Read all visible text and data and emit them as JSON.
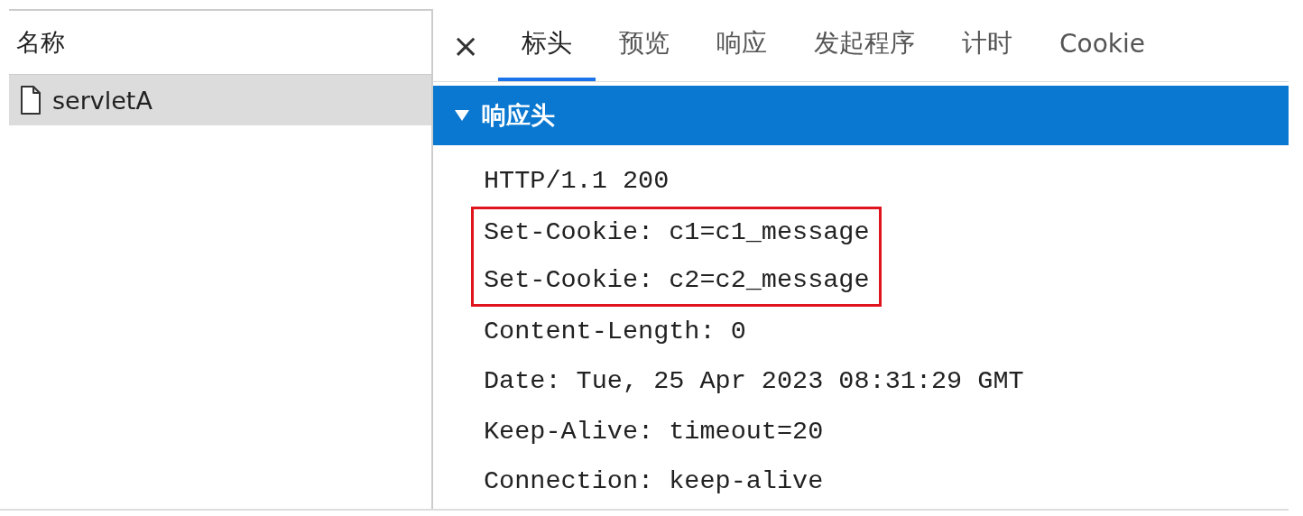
{
  "request_list": {
    "header": "名称",
    "items": [
      {
        "name": "servletA",
        "selected": true
      }
    ]
  },
  "close_label": "×",
  "tabs": [
    {
      "label": "标头",
      "selected": true
    },
    {
      "label": "预览",
      "selected": false
    },
    {
      "label": "响应",
      "selected": false
    },
    {
      "label": "发起程序",
      "selected": false
    },
    {
      "label": "计时",
      "selected": false
    },
    {
      "label": "Cookie",
      "selected": false
    }
  ],
  "section": {
    "title": "响应头",
    "expanded": true,
    "lines": [
      {
        "text": "HTTP/1.1 200",
        "highlighted": false
      },
      {
        "text": "Set-Cookie: c1=c1_message",
        "highlighted": true
      },
      {
        "text": "Set-Cookie: c2=c2_message",
        "highlighted": true
      },
      {
        "text": "Content-Length: 0",
        "highlighted": false
      },
      {
        "text": "Date: Tue, 25 Apr 2023 08:31:29 GMT",
        "highlighted": false
      },
      {
        "text": "Keep-Alive: timeout=20",
        "highlighted": false
      },
      {
        "text": "Connection: keep-alive",
        "highlighted": false
      }
    ]
  }
}
